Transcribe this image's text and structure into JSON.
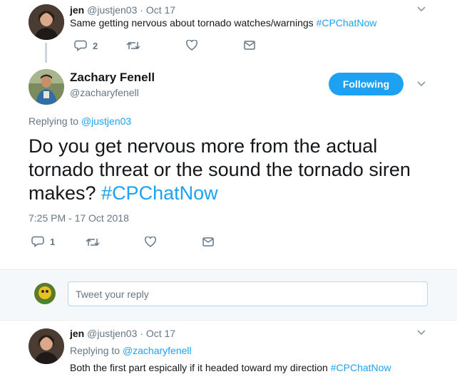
{
  "parent_tweet": {
    "name": "jen",
    "handle": "@justjen03",
    "sep": "·",
    "date": "Oct 17",
    "text_plain": "Same getting nervous about tornado watches/warnings ",
    "hashtag": "#CPChatNow",
    "reply_count": "2"
  },
  "main_tweet": {
    "name": "Zachary Fenell",
    "handle": "@zacharyfenell",
    "follow_label": "Following",
    "replying_prefix": "Replying to ",
    "replying_handle": "@justjen03",
    "text_line1": "Do you get nervous more from the actual",
    "text_line2": "tornado threat or the sound the tornado siren",
    "text_line3_plain": "makes? ",
    "hashtag": "#CPChatNow",
    "timestamp": "7:25 PM - 17 Oct 2018",
    "reply_count": "1"
  },
  "reply_box": {
    "placeholder": "Tweet your reply"
  },
  "reply_tweet": {
    "name": "jen",
    "handle": "@justjen03",
    "sep": "·",
    "date": "Oct 17",
    "replying_prefix": "Replying to ",
    "replying_handle": "@zacharyfenell",
    "text_plain": "Both the first part espically if it headed toward my direction ",
    "hashtag": "#CPChatNow"
  },
  "colors": {
    "accent": "#1da1f2",
    "muted": "#657786",
    "text": "#14171a",
    "divider": "#e6ecf0",
    "reply_bg": "#f5f8fa"
  },
  "icons": [
    "reply-icon",
    "retweet-icon",
    "like-icon",
    "direct-message-icon",
    "chevron-down-icon"
  ]
}
